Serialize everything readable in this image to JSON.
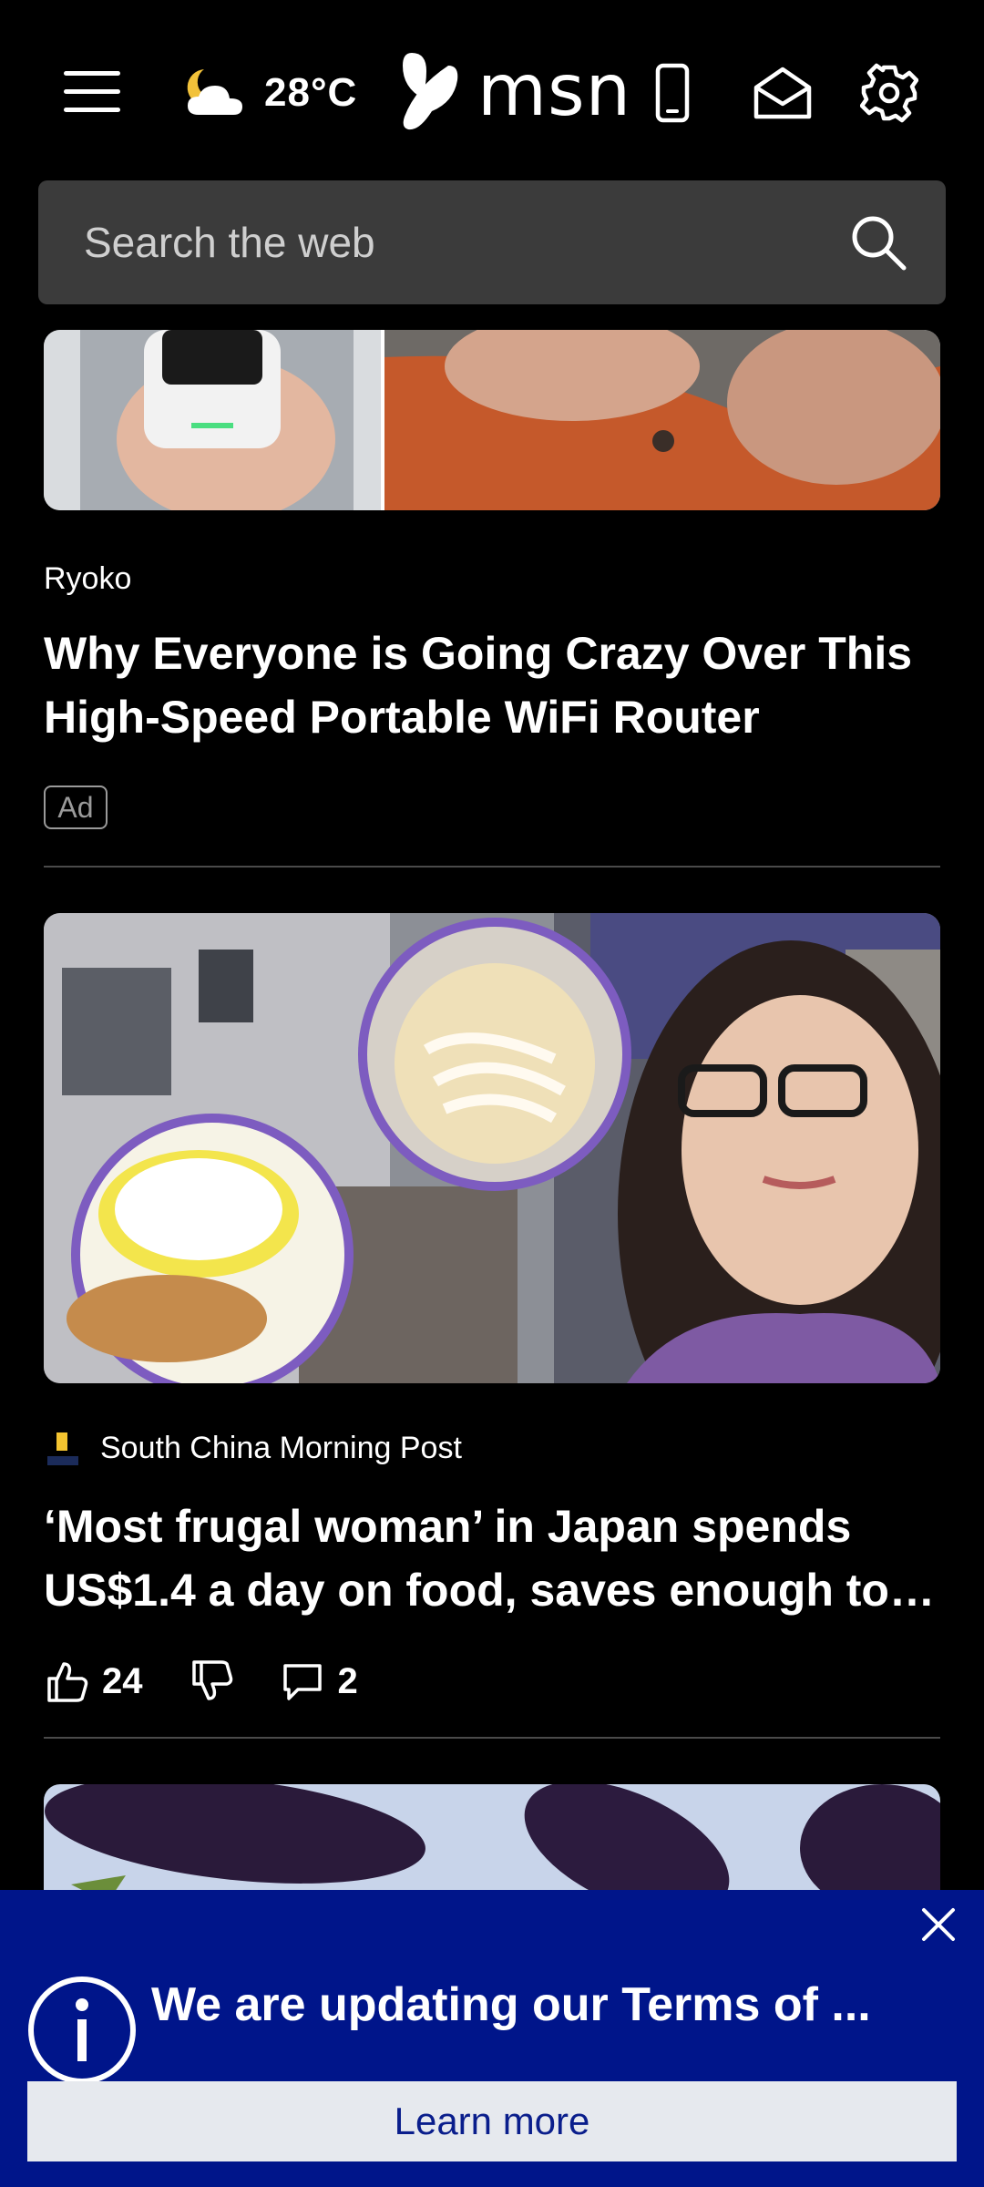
{
  "header": {
    "weather": {
      "temperature": "28°C",
      "icon": "partly-cloudy-night-icon"
    },
    "logo_text": "msn",
    "icons": [
      "menu-icon",
      "phone-icon",
      "mail-icon",
      "gear-icon"
    ]
  },
  "search": {
    "placeholder": "Search the web"
  },
  "feed": [
    {
      "source": "Ryoko",
      "headline": "Why Everyone is Going Crazy Over This High-Speed Portable WiFi Router",
      "badge": "Ad"
    },
    {
      "source": "South China Morning Post",
      "headline": "‘Most frugal woman’ in Japan spends US$1.4 a day on food, saves enough to…",
      "likes": "24",
      "comments": "2"
    }
  ],
  "banner": {
    "message": "We are updating our Terms of ...",
    "button": "Learn more"
  },
  "colors": {
    "banner_bg": "#00158a",
    "search_bg": "#3b3b3b",
    "background": "#000000"
  }
}
